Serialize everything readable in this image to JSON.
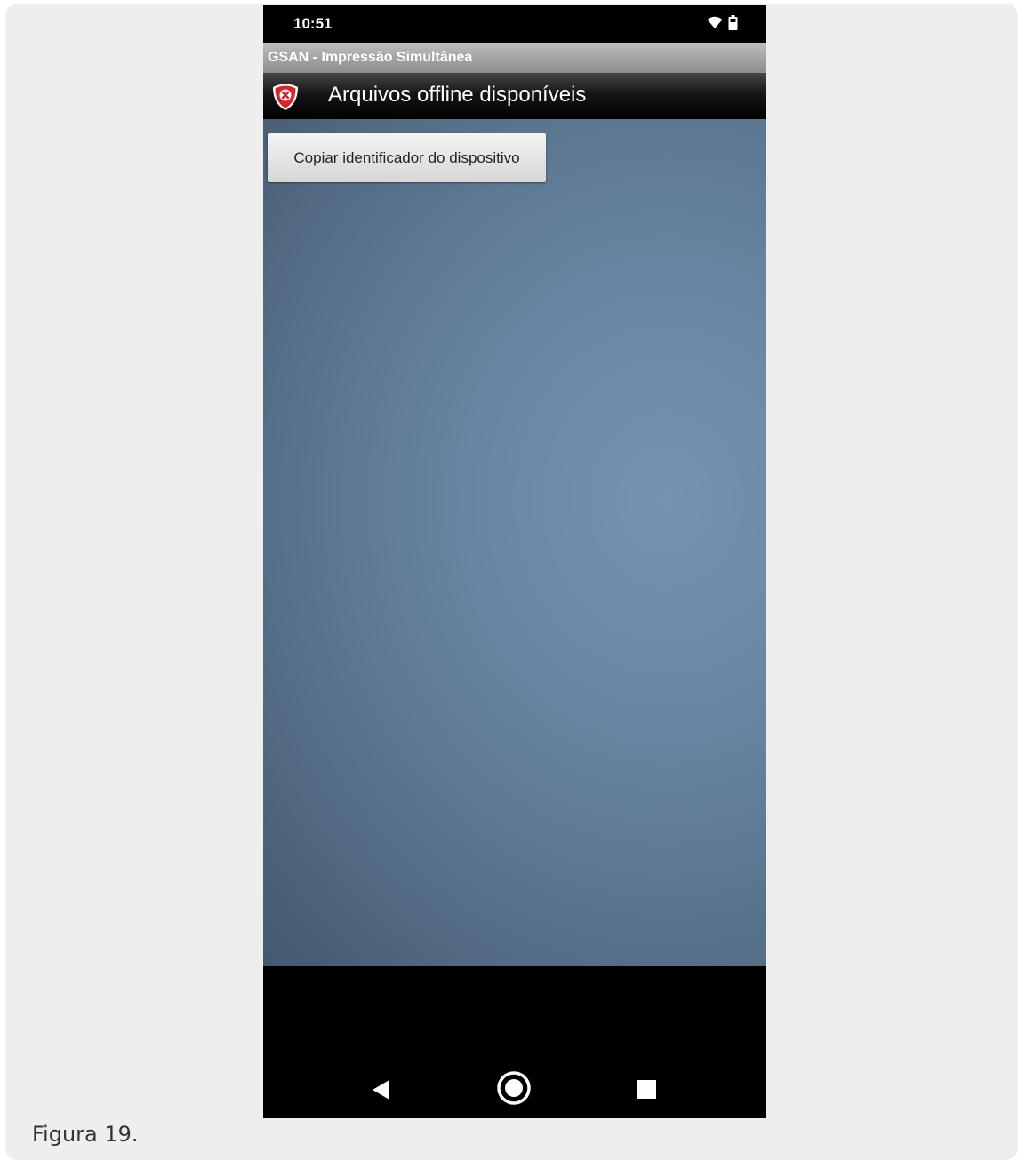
{
  "status_bar": {
    "time": "10:51",
    "icons": [
      "wifi-icon",
      "battery-icon"
    ]
  },
  "app": {
    "title": "GSAN - Impressão Simultânea"
  },
  "header": {
    "icon": "app-shield-icon",
    "title": "Arquivos offline disponíveis"
  },
  "main": {
    "copy_button_label": "Copiar identificador do dispositivo"
  },
  "nav_bar": {
    "buttons": [
      "back-icon",
      "home-icon",
      "recent-apps-icon"
    ]
  },
  "caption": "Figura 19.",
  "colors": {
    "content_background": "#6886a1",
    "header_background": "#000000",
    "app_title_bar": "#a5a5a5",
    "shield_red": "#d8232a"
  }
}
